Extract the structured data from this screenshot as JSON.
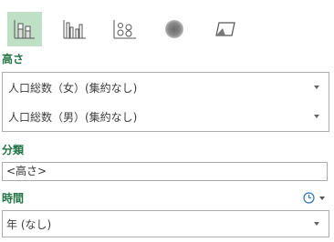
{
  "toolbar": {
    "buttons": [
      {
        "icon": "stacked-column-icon",
        "selected": true
      },
      {
        "icon": "clustered-column-icon",
        "selected": false
      },
      {
        "icon": "bubble-icon",
        "selected": false
      },
      {
        "icon": "heatmap-icon",
        "selected": false
      },
      {
        "icon": "region-icon",
        "selected": false
      }
    ]
  },
  "height": {
    "label": "高さ",
    "fields": [
      {
        "value": "人口総数（女）(集約なし)"
      },
      {
        "value": "人口総数（男）(集約なし)"
      }
    ]
  },
  "category": {
    "label": "分類",
    "value": "<高さ>"
  },
  "time": {
    "label": "時間",
    "clock_icon": "clock-icon",
    "value": "年 (なし)"
  },
  "colors": {
    "accent": "#217346",
    "selected_bg": "#bfe0c6",
    "icon_blue": "#2e75b6"
  }
}
